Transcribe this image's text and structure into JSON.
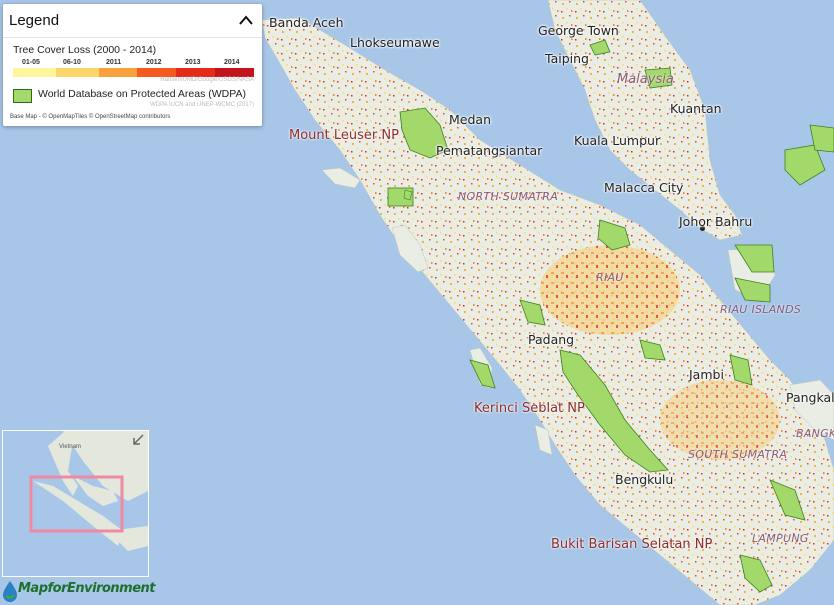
{
  "legend": {
    "title": "Legend",
    "tree_cover_loss_title": "Tree Cover Loss (2000 - 2014)",
    "year_labels": [
      "01-05",
      "06-10",
      "2011",
      "2012",
      "2013",
      "2014"
    ],
    "colors": [
      "#fff59b",
      "#fcd56b",
      "#f9a23b",
      "#f55a1e",
      "#e52a1a",
      "#c2141a"
    ],
    "tcl_source": "Hansen/UMD/Google/USGS/NASA",
    "wdpa_label": "World Database on Protected Areas (WDPA)",
    "wdpa_source": "WDPA IUCN and UNEP-WCMC (2017)",
    "basemap_credit": "Base Map - © OpenMapTiles © OpenStreetMap contributors",
    "wdpa_color": "#a3d96a"
  },
  "map": {
    "cities": [
      "Banda Aceh",
      "Lhokseumawe",
      "George Town",
      "Taiping",
      "Kuantan",
      "Medan",
      "Kuala Lumpur",
      "Pematangsiantar",
      "Malacca City",
      "Johor Bahru",
      "Padang",
      "Jambi",
      "Pangkal",
      "Bengkulu"
    ],
    "national_parks": [
      "Mount Leuser NP",
      "Kerinci Seblat NP",
      "Bukit Barisan Selatan NP"
    ],
    "regions": [
      "NORTH SUMATRA",
      "RIAU",
      "RIAU ISLANDS",
      "SOUTH SUMATRA",
      "LAMPUNG",
      "BANGKA"
    ],
    "country": "Malaysia"
  },
  "minimap": {
    "label": "Vietnam"
  },
  "logo": {
    "text": "MapforEnvironment"
  }
}
